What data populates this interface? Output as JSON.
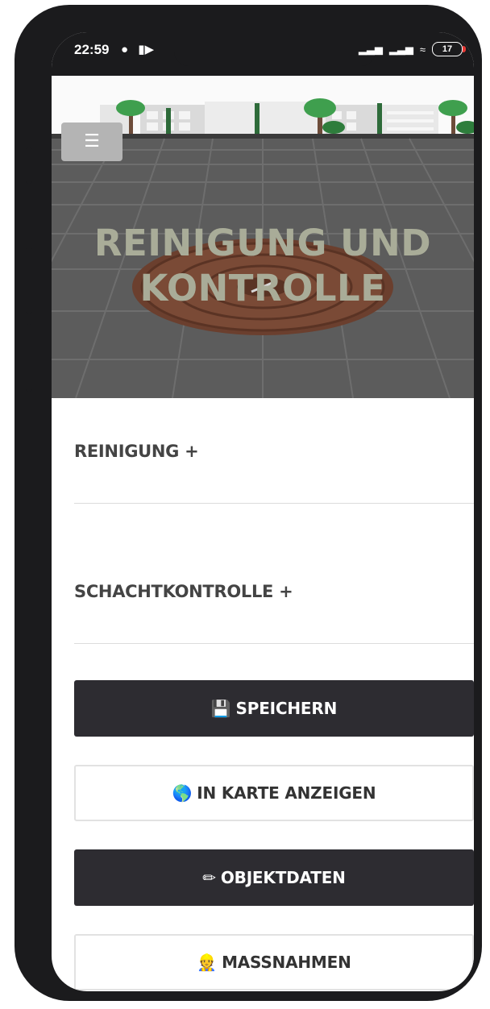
{
  "status_bar": {
    "time": "22:59",
    "left_icons": [
      "shield-icon",
      "camera-icon"
    ],
    "right_icons": [
      "signal-icon",
      "signal-icon",
      "wifi-icon"
    ],
    "battery": "17",
    "battery_color": "#e53935"
  },
  "hero": {
    "title_line1": "REINIGUNG UND",
    "title_line2": "KONTROLLE",
    "menu_icon": "hamburger-icon"
  },
  "sections": [
    {
      "label": "REINIGUNG +"
    },
    {
      "label": "SCHACHTKONTROLLE +"
    }
  ],
  "buttons": {
    "save": {
      "icon": "floppy-disk-icon",
      "label": "SPEICHERN"
    },
    "map": {
      "icon": "globe-icon",
      "label": "IN KARTE ANZEIGEN"
    },
    "object_data": {
      "icon": "pencil-icon",
      "label": "OBJEKTDATEN"
    },
    "measures": {
      "icon": "construction-worker-icon",
      "label": "MASSNAHMEN"
    }
  },
  "colors": {
    "dark_button": "#2d2c31",
    "hero_title": "#a9ac98",
    "section_text": "#444444"
  }
}
